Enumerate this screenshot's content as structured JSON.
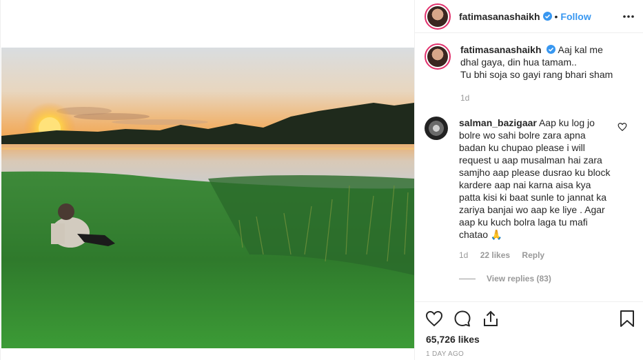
{
  "post": {
    "username": "fatimasanashaikh",
    "follow_label": "Follow",
    "separator": "•",
    "likes": "65,726 likes",
    "timestamp": "1 DAY AGO"
  },
  "caption": {
    "username": "fatimasanashaikh",
    "line1": "Aaj kal me dhal gaya, din hua tamam..",
    "line2": "Tu bhi soja so gayi rang bhari sham",
    "age": "1d"
  },
  "comment": {
    "username": "salman_bazigaar",
    "text": "Aap ku log jo bolre wo sahi bolre zara apna badan ku chupao please i will request u aap musalman hai zara samjho aap please dusrao ku block kardere aap nai karna aisa kya patta kisi ki baat sunle to jannat ka zariya banjai wo aap ke liye . Agar aap ku kuch bolra laga tu mafi chatao 🙏",
    "age": "1d",
    "likes": "22 likes",
    "reply_label": "Reply",
    "view_replies": "View replies (83)"
  },
  "icons": {
    "header": [
      "more-options-icon"
    ],
    "actions": [
      "heart-icon",
      "comment-icon",
      "share-icon",
      "bookmark-icon"
    ],
    "comment": [
      "heart-icon"
    ]
  },
  "colors": {
    "accent": "#3897f0",
    "muted": "#999999",
    "text": "#262626",
    "story_ring": "#e1306c"
  }
}
